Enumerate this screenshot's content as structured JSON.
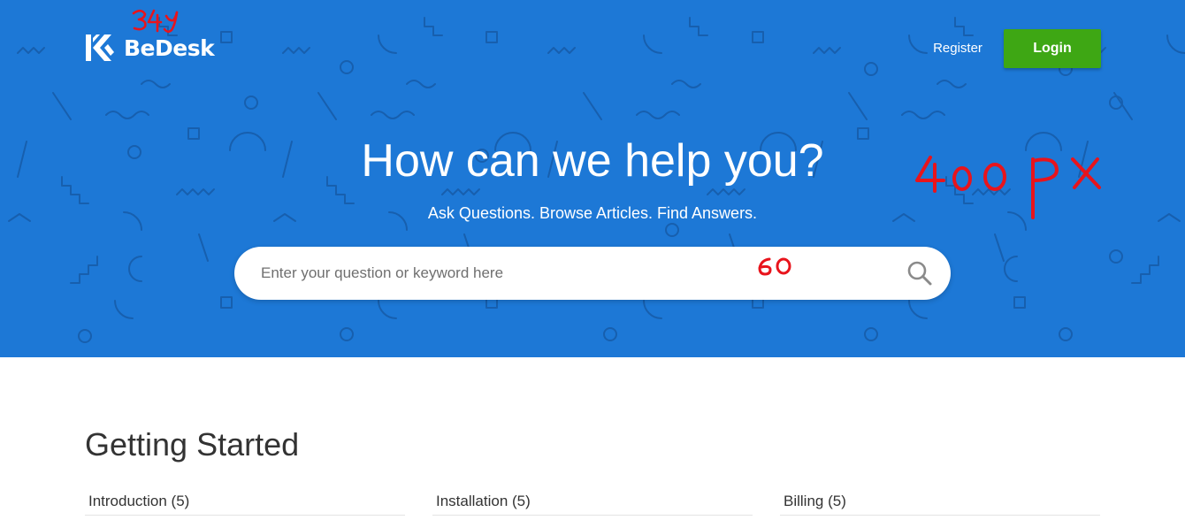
{
  "header": {
    "logo_text": "BeDesk",
    "register_label": "Register",
    "login_label": "Login"
  },
  "hero": {
    "title": "How can we help you?",
    "subtitle": "Ask Questions. Browse Articles. Find Answers.",
    "search_placeholder": "Enter your question or keyword here"
  },
  "annotations": {
    "logo_note": "34",
    "hero_note": "400PX",
    "search_note": "60"
  },
  "section": {
    "title": "Getting Started",
    "categories": [
      {
        "label": "Introduction (5)"
      },
      {
        "label": "Installation (5)"
      },
      {
        "label": "Billing (5)"
      }
    ]
  },
  "colors": {
    "hero_bg": "#1d78d6",
    "login_bg": "#3ea714",
    "annotation_red": "#e8141c"
  },
  "icons": {
    "logo": "bedesk-logo-icon",
    "search": "search-icon"
  }
}
